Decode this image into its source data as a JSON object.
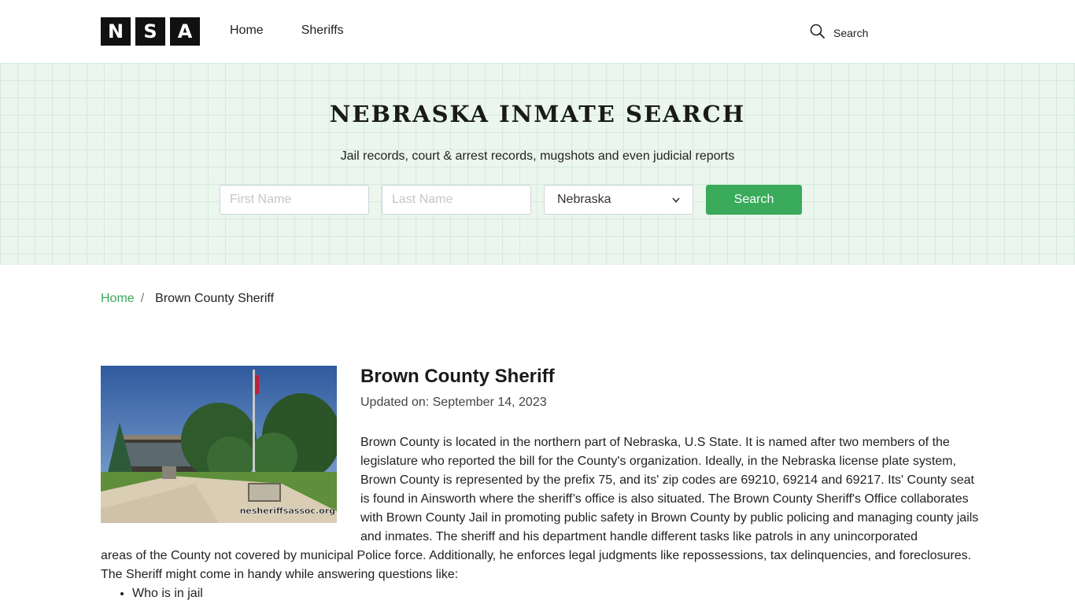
{
  "header": {
    "logo_letters": [
      "N",
      "S",
      "A"
    ],
    "nav": [
      "Home",
      "Sheriffs"
    ],
    "search_label": "Search"
  },
  "hero": {
    "title": "NEBRASKA INMATE SEARCH",
    "subtitle": "Jail records, court & arrest records, mugshots and even judicial reports",
    "first_name_placeholder": "First Name",
    "last_name_placeholder": "Last Name",
    "state_selected": "Nebraska",
    "search_button": "Search"
  },
  "breadcrumb": {
    "home": "Home",
    "separator": "/",
    "current": "Brown County Sheriff"
  },
  "article": {
    "image_watermark": "nesheriffsassoc.org",
    "title": "Brown County Sheriff",
    "updated": "Updated on: September 14, 2023",
    "body_first": "Brown County is located in the northern part of Nebraska, U.S State. It is named after two members of the legislature who reported the bill for the County's organization. Ideally, in the Nebraska license plate system, Brown County is represented by the prefix 75, and its' zip codes are 69210, 69214 and 69217. Its' County seat is found in Ainsworth where the sheriff’s office is also situated. The Brown County Sheriff's Office collaborates with Brown County Jail in promoting public safety in Brown County by public policing and managing county jails and inmates. The sheriff and his department handle different tasks like patrols in any unincorporated",
    "body_rest": "areas of the County not covered by municipal Police force. Additionally, he enforces legal judgments like repossessions, tax delinquencies, and foreclosures. The Sheriff might come in handy while answering questions like:",
    "list": [
      "Who is in jail"
    ]
  },
  "colors": {
    "accent": "#3aaa5b",
    "hero_bg": "#eaf6ee",
    "logo_bg": "#111111"
  }
}
